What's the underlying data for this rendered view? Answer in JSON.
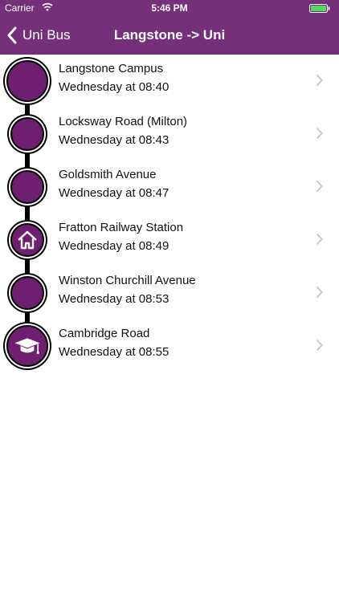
{
  "status": {
    "carrier": "Carrier",
    "time": "5:46 PM",
    "icons": [
      "wifi-icon",
      "battery-icon"
    ]
  },
  "nav": {
    "back_label": "Uni Bus",
    "title": "Langstone -> Uni"
  },
  "colors": {
    "brand": "#75307a",
    "marker": "#6f1f70",
    "track": "#000000",
    "chevron": "#c7c7cc"
  },
  "stops": [
    {
      "name": "Langstone Campus",
      "time": "Wednesday at 08:40",
      "icon": "none"
    },
    {
      "name": "Locksway Road (Milton)",
      "time": "Wednesday at 08:43",
      "icon": "none"
    },
    {
      "name": "Goldsmith Avenue",
      "time": "Wednesday at 08:47",
      "icon": "none"
    },
    {
      "name": "Fratton Railway Station",
      "time": "Wednesday at 08:49",
      "icon": "house-icon"
    },
    {
      "name": "Winston Churchill Avenue",
      "time": "Wednesday at 08:53",
      "icon": "none"
    },
    {
      "name": "Cambridge Road",
      "time": "Wednesday at 08:55",
      "icon": "graduation-cap-icon"
    }
  ]
}
